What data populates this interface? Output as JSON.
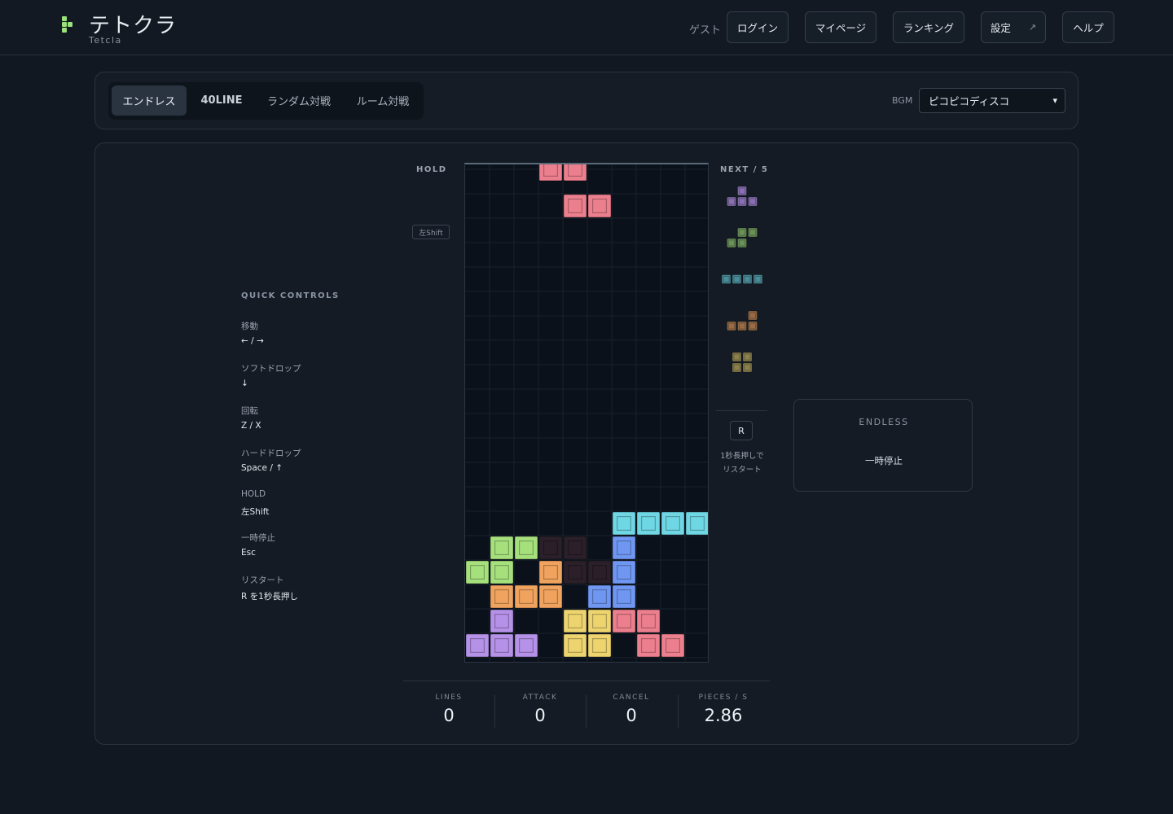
{
  "header": {
    "logo_title": "テトクラ",
    "logo_sub": "Tetcla",
    "guest_label": "ゲスト",
    "nav": {
      "login": "ログイン",
      "mypage": "マイページ",
      "ranking": "ランキング",
      "settings": "設定",
      "settings_ext_icon": "↗",
      "help": "ヘルプ"
    }
  },
  "modes": {
    "tabs": [
      "エンドレス",
      "40LINE",
      "ランダム対戦",
      "ルーム対戦"
    ],
    "active_tab": "エンドレス",
    "bgm_label": "BGM",
    "bgm_selected": "ピコピコディスコ"
  },
  "quick_controls": {
    "title": "QUICK CONTROLS",
    "items": [
      {
        "label": "移動",
        "value": "← / →"
      },
      {
        "label": "ソフトドロップ",
        "value": "↓"
      },
      {
        "label": "回転",
        "value": "Z / X"
      },
      {
        "label": "ハードドロップ",
        "value": "Space / ↑"
      },
      {
        "label": "HOLD",
        "value": "左Shift"
      },
      {
        "label": "一時停止",
        "value": "Esc"
      },
      {
        "label": "リスタート",
        "value": "R を1秒長押し"
      }
    ]
  },
  "hold": {
    "title": "HOLD",
    "key_hint": "左Shift"
  },
  "next": {
    "title": "NEXT / 5",
    "queue": [
      "T",
      "S",
      "I",
      "L",
      "O"
    ]
  },
  "restart": {
    "key": "R",
    "hint_line1": "1秒長押しで",
    "hint_line2": "リスタート"
  },
  "mode_card": {
    "title": "ENDLESS",
    "status": "一時停止"
  },
  "stats": [
    {
      "label": "LINES",
      "value": "0"
    },
    {
      "label": "ATTACK",
      "value": "0"
    },
    {
      "label": "CANCEL",
      "value": "0"
    },
    {
      "label": "PIECES / S",
      "value": "2.86"
    }
  ],
  "colors": {
    "T": "#b591e8",
    "S": "#a6e07c",
    "Z": "#ec7f8d",
    "I": "#6fd6e4",
    "J": "#6f97f2",
    "L": "#f0a35e",
    "O": "#eed46f",
    "garbage": "#2b1f29",
    "accent": "#9be27a"
  },
  "board": {
    "cols": 10,
    "rows": 20,
    "active_piece": {
      "type": "Z",
      "cells": [
        [
          3,
          -0.5
        ],
        [
          4,
          -0.5
        ],
        [
          4,
          1
        ],
        [
          5,
          1
        ]
      ]
    },
    "cells": [
      [
        6,
        14,
        "I"
      ],
      [
        7,
        14,
        "I"
      ],
      [
        8,
        14,
        "I"
      ],
      [
        9,
        14,
        "I"
      ],
      [
        1,
        15,
        "S"
      ],
      [
        2,
        15,
        "S"
      ],
      [
        3,
        15,
        "garbage"
      ],
      [
        4,
        15,
        "garbage"
      ],
      [
        6,
        15,
        "J"
      ],
      [
        0,
        16,
        "S"
      ],
      [
        1,
        16,
        "S"
      ],
      [
        3,
        16,
        "L"
      ],
      [
        4,
        16,
        "garbage"
      ],
      [
        5,
        16,
        "garbage"
      ],
      [
        6,
        16,
        "J"
      ],
      [
        1,
        17,
        "L"
      ],
      [
        2,
        17,
        "L"
      ],
      [
        3,
        17,
        "L"
      ],
      [
        5,
        17,
        "J"
      ],
      [
        6,
        17,
        "J"
      ],
      [
        1,
        18,
        "T"
      ],
      [
        4,
        18,
        "O"
      ],
      [
        5,
        18,
        "O"
      ],
      [
        6,
        18,
        "Z"
      ],
      [
        7,
        18,
        "Z"
      ],
      [
        0,
        19,
        "T"
      ],
      [
        1,
        19,
        "T"
      ],
      [
        2,
        19,
        "T"
      ],
      [
        4,
        19,
        "O"
      ],
      [
        5,
        19,
        "O"
      ],
      [
        7,
        19,
        "Z"
      ],
      [
        8,
        19,
        "Z"
      ]
    ]
  }
}
